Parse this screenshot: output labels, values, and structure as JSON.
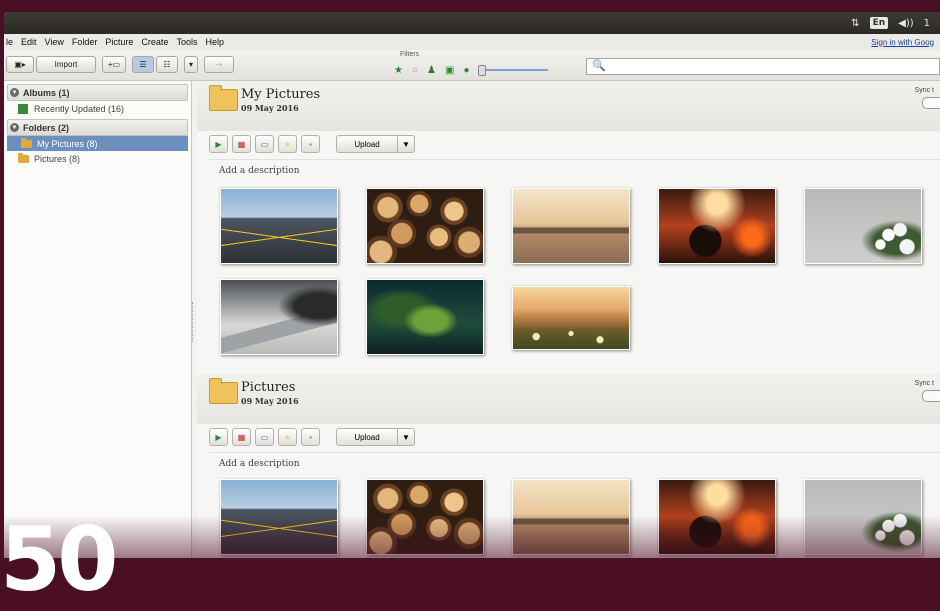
{
  "topbar": {
    "network_icon": "network-arrows-icon",
    "lang": "En",
    "volume_icon": "volume-icon",
    "extra": "1"
  },
  "menu": {
    "items": [
      "le",
      "Edit",
      "View",
      "Folder",
      "Picture",
      "Create",
      "Tools",
      "Help"
    ],
    "signin": "Sign in with Goog"
  },
  "toolbar": {
    "import_label": "Import",
    "filters_label": "Filters"
  },
  "sidebar": {
    "albums_header": "Albums (1)",
    "albums": [
      {
        "label": "Recently Updated (16)"
      }
    ],
    "folders_header": "Folders (2)",
    "folders": [
      {
        "label": "My Pictures (8)",
        "selected": true
      },
      {
        "label": "Pictures (8)",
        "selected": false
      }
    ]
  },
  "sections": [
    {
      "title": "My Pictures",
      "date": "09 May 2016",
      "sync": "Sync t",
      "upload": "Upload",
      "description": "Add a description"
    },
    {
      "title": "Pictures",
      "date": "09 May 2016",
      "sync": "Sync t",
      "upload": "Upload",
      "description": "Add a description"
    }
  ],
  "overlay": {
    "text": "50"
  }
}
